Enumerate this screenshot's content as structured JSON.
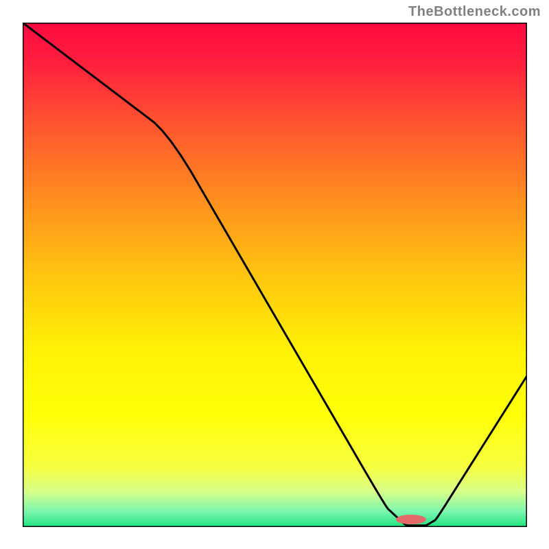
{
  "attribution": "TheBottleneck.com",
  "chart_data": {
    "type": "line",
    "title": "",
    "xlabel": "",
    "ylabel": "",
    "xlim": [
      0,
      100
    ],
    "ylim": [
      0,
      100
    ],
    "x": [
      0,
      29,
      72,
      76,
      80,
      82,
      100
    ],
    "values": [
      100,
      78,
      4,
      0.3,
      0.3,
      1.5,
      30
    ],
    "marker": {
      "x": 77,
      "y": 1.5,
      "color": "#e46a6a"
    },
    "background_gradient": [
      {
        "stop": 0.0,
        "color": "#ff0a41"
      },
      {
        "stop": 0.08,
        "color": "#ff1f3d"
      },
      {
        "stop": 0.2,
        "color": "#ff5430"
      },
      {
        "stop": 0.35,
        "color": "#ff8e1e"
      },
      {
        "stop": 0.5,
        "color": "#ffc50f"
      },
      {
        "stop": 0.65,
        "color": "#fff205"
      },
      {
        "stop": 0.78,
        "color": "#ffff08"
      },
      {
        "stop": 0.88,
        "color": "#f7ff40"
      },
      {
        "stop": 0.93,
        "color": "#d8ff8a"
      },
      {
        "stop": 0.97,
        "color": "#79f6af"
      },
      {
        "stop": 1.0,
        "color": "#1ee27c"
      }
    ]
  },
  "plot": {
    "frame_color": "#000000",
    "frame_width": 3,
    "line_color": "#000000",
    "line_width": 3,
    "marker_rx": 22,
    "marker_ry": 7
  }
}
